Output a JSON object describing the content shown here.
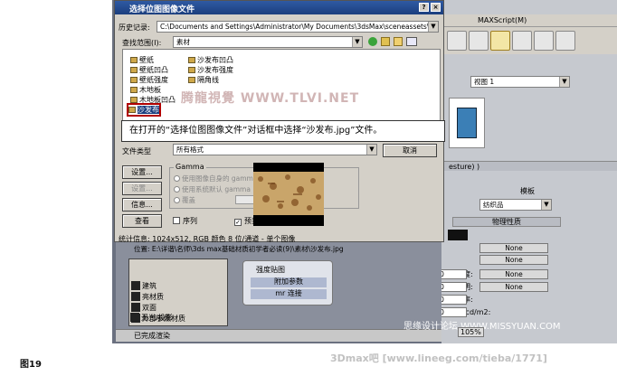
{
  "max_menu": {
    "item": "MAXScript(M)"
  },
  "dialog": {
    "title": "选择位图图像文件",
    "history_label": "历史记录:",
    "history_path": "C:\\Documents and Settings\\Administrator\\My Documents\\3dsMax\\sceneassets\\images",
    "lookin_label": "查找范围(I):",
    "lookin_value": "素材",
    "files": [
      "壁纸",
      "壁纸凹凸",
      "壁纸强度",
      "木地板",
      "木地板凹凸",
      "沙发布",
      "沙发布凹凸",
      "沙发布强度",
      "隔角线"
    ],
    "filetype_label": "文件类型",
    "filetype_value": "所有格式",
    "cancel": "取消",
    "buttons": {
      "setup": "设置...",
      "info_btn": "设置...",
      "info": "信息...",
      "view": "查看"
    },
    "gamma": {
      "title": "Gamma",
      "opt1": "使用图像自身的 gamma",
      "opt2": "使用系统默认 gamma",
      "opt3": "覆盖"
    },
    "sequence": "序列",
    "preview": "预览",
    "stats": "统计信息: 1024x512, RGB 颜色 8 位/通道 - 单个图像",
    "location": "位置: E:\\详谐\\名师\\3ds max基础材质初学者必读(9)\\素材\\沙发布.jpg"
  },
  "watermark": "腾龍視覺 WWW.TLVI.NET",
  "callout": "在打开的“选择位图图像文件”对话框中选择“沙发布.jpg”文件。",
  "right_panel": {
    "view_label": "视图 1",
    "tab": "esture) )",
    "mode_label": "模板",
    "mode_value": "纺织品",
    "section": "物理性质",
    "rows": [
      {
        "label": "透明度:",
        "value": "0.0",
        "map": "None"
      },
      {
        "label": "半透明:",
        "value": "0.0",
        "map": "None"
      },
      {
        "label": "折射率:",
        "value": "1.0",
        "map": ""
      },
      {
        "label": "亮度 cd/m2:",
        "value": "0.0",
        "map": ""
      }
    ],
    "none_top": [
      "None",
      "None",
      "None"
    ]
  },
  "material_list": [
    "建筑",
    "亮材质",
    "双面",
    "外部参照材质",
    "无光/投影"
  ],
  "nodes": {
    "n1": "强度贴图",
    "n2": "附加参数",
    "n3": "mr 连接"
  },
  "status": "已完成渲染",
  "zoom": "105%",
  "bottom_watermark": "思缘设计论坛 WWW.MISSYUAN.COM",
  "caption_left": "图19",
  "caption_right": "3Dmax吧 [www.lineeg.com/tieba/1771]"
}
